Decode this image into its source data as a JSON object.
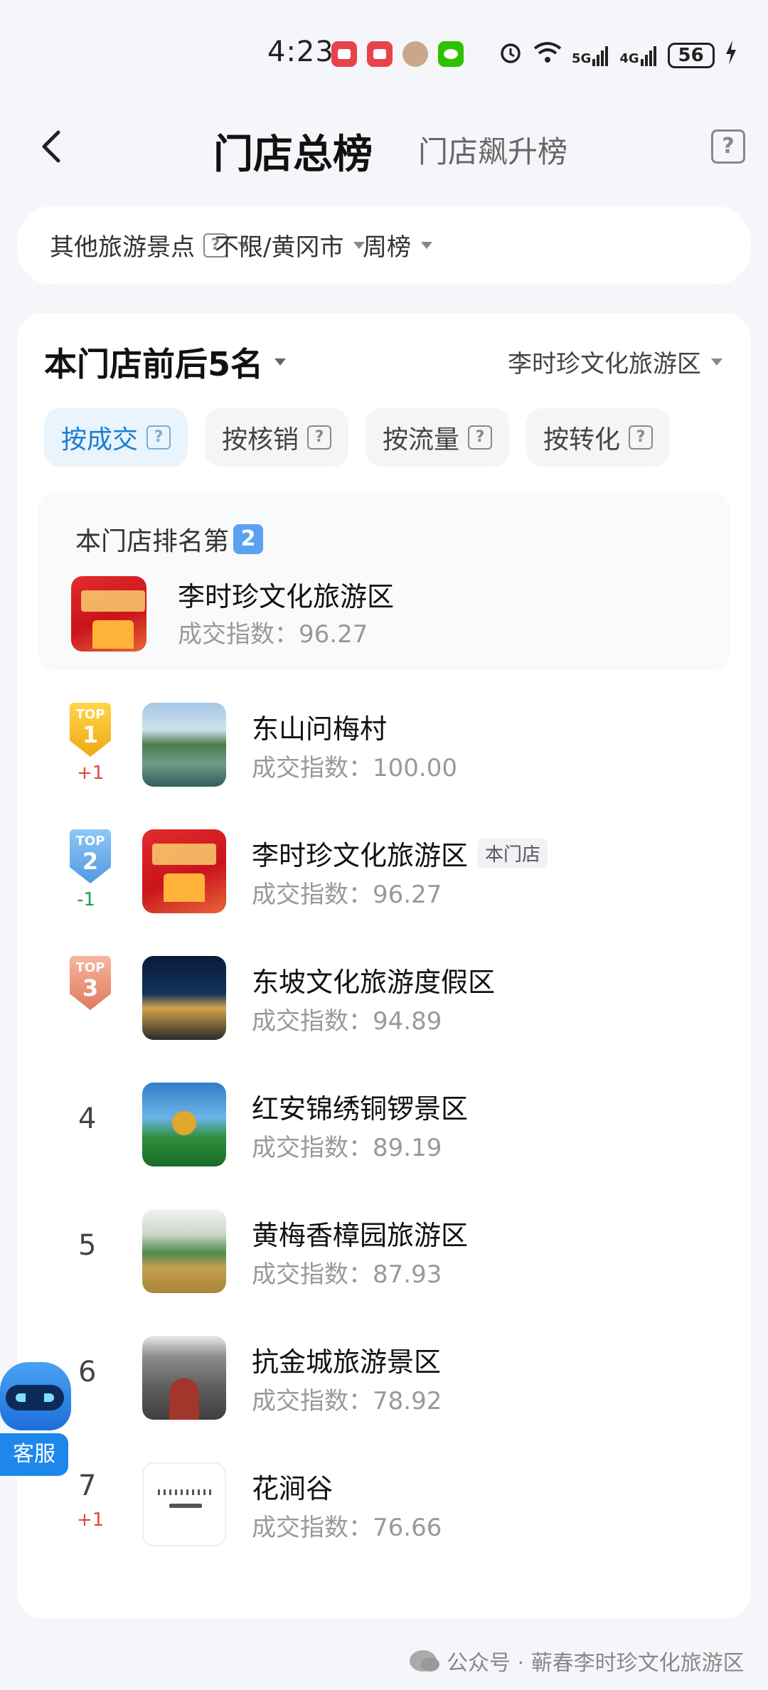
{
  "status_bar": {
    "time": "4:23",
    "signal_5g": "5G",
    "signal_4g": "4G",
    "battery": "56"
  },
  "header": {
    "title": "门店总榜",
    "subtitle": "门店飙升榜",
    "help": "?"
  },
  "filters": {
    "category": "其他旅游景点",
    "region": "不限/黄冈市",
    "period": "周榜",
    "help": "?"
  },
  "card": {
    "title": "本门店前后5名",
    "store_select": "李时珍文化旅游区",
    "tabs": [
      {
        "label": "按成交",
        "active": true
      },
      {
        "label": "按核销",
        "active": false
      },
      {
        "label": "按流量",
        "active": false
      },
      {
        "label": "按转化",
        "active": false
      }
    ],
    "my_rank": {
      "label": "本门店排名第",
      "rank": "2",
      "name": "李时珍文化旅游区",
      "index_text": "成交指数：96.27"
    },
    "list": [
      {
        "medal": "gold",
        "top": "TOP",
        "rank": "1",
        "change": "+1",
        "change_dir": "up",
        "name": "东山问梅村",
        "index_text": "成交指数：100.00",
        "thumb": "village",
        "tag": ""
      },
      {
        "medal": "silver",
        "top": "TOP",
        "rank": "2",
        "change": "-1",
        "change_dir": "down",
        "name": "李时珍文化旅游区",
        "index_text": "成交指数：96.27",
        "thumb": "red",
        "tag": "本门店"
      },
      {
        "medal": "bronze",
        "top": "TOP",
        "rank": "3",
        "change": "",
        "change_dir": "",
        "name": "东坡文化旅游度假区",
        "index_text": "成交指数：94.89",
        "thumb": "night",
        "tag": ""
      },
      {
        "medal": "",
        "top": "",
        "rank": "4",
        "change": "",
        "change_dir": "",
        "name": "红安锦绣铜锣景区",
        "index_text": "成交指数：89.19",
        "thumb": "sky",
        "tag": ""
      },
      {
        "medal": "",
        "top": "",
        "rank": "5",
        "change": "",
        "change_dir": "",
        "name": "黄梅香樟园旅游区",
        "index_text": "成交指数：87.93",
        "thumb": "field",
        "tag": ""
      },
      {
        "medal": "",
        "top": "",
        "rank": "6",
        "change": "",
        "change_dir": "",
        "name": "抗金城旅游景区",
        "index_text": "成交指数：78.92",
        "thumb": "fort",
        "tag": ""
      },
      {
        "medal": "",
        "top": "",
        "rank": "7",
        "change": "+1",
        "change_dir": "up",
        "name": "花涧谷",
        "index_text": "成交指数：76.66",
        "thumb": "logo",
        "tag": ""
      }
    ]
  },
  "customer_service": {
    "label": "客服"
  },
  "footer": {
    "text": "公众号 · 蕲春李时珍文化旅游区"
  },
  "colors": {
    "accent": "#1a7fd1",
    "up": "#e04a3c",
    "down": "#18a058"
  }
}
